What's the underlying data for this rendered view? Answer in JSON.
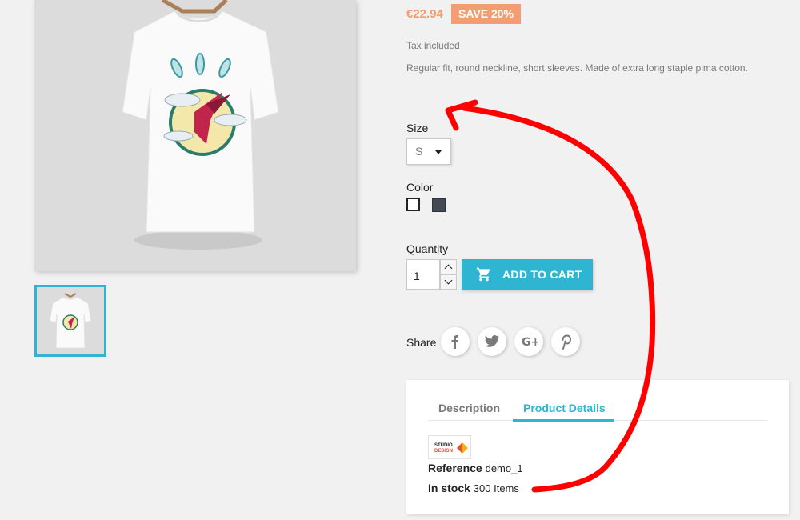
{
  "product": {
    "price": "€22.94",
    "discount": "SAVE 20%",
    "tax_label": "Tax included",
    "description": "Regular fit, round neckline, short sleeves. Made of extra long staple pima cotton."
  },
  "size": {
    "label": "Size",
    "selected": "S"
  },
  "color": {
    "label": "Color",
    "options": [
      "white",
      "grey"
    ],
    "hex": [
      "#ffffff",
      "#434a54"
    ]
  },
  "quantity": {
    "label": "Quantity",
    "value": "1"
  },
  "cart": {
    "button_label": "ADD TO CART"
  },
  "share": {
    "label": "Share",
    "networks": [
      "facebook",
      "twitter",
      "google-plus",
      "pinterest"
    ]
  },
  "tabs": {
    "items": [
      "Description",
      "Product Details"
    ],
    "active": "Product Details"
  },
  "details": {
    "brand_logo_line1": "STUDIO",
    "brand_logo_line2": "DESIGN",
    "reference_label": "Reference",
    "reference_value": "demo_1",
    "stock_label": "In stock",
    "stock_value": "300 Items"
  },
  "colors": {
    "accent": "#2fb5d2",
    "price": "#f39d72",
    "annotation": "#ff0000"
  }
}
